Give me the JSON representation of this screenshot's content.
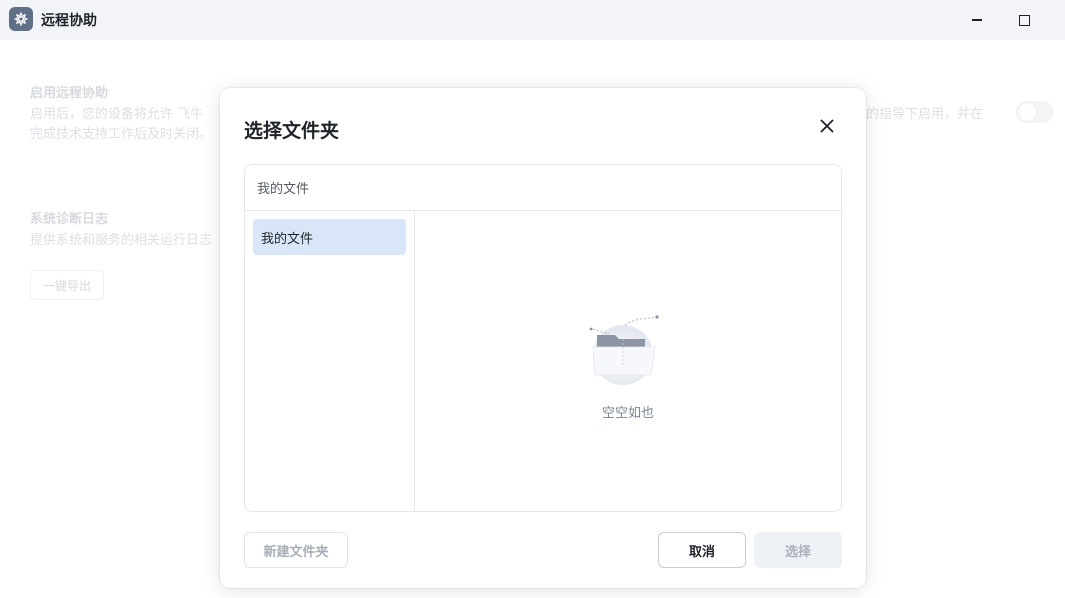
{
  "app": {
    "title": "远程协助",
    "icon": "gear-icon"
  },
  "background": {
    "remote_assist": {
      "title": "启用远程协助",
      "desc_line1_left": "启用后，您的设备将允许 飞牛",
      "desc_line1_right": "的指导下启用，并在",
      "desc_line2": "完成技术支持工作后及时关闭。"
    },
    "diag_log": {
      "title": "系统诊断日志",
      "desc": "提供系统和服务的相关运行日志",
      "export_label": "一键导出"
    }
  },
  "dialog": {
    "title": "选择文件夹",
    "path": "我的文件",
    "tree_items": [
      {
        "label": "我的文件",
        "selected": true
      }
    ],
    "empty_text": "空空如也",
    "new_folder_label": "新建文件夹",
    "cancel_label": "取消",
    "select_label": "选择"
  },
  "colors": {
    "accent_selected": "#d9e6f7",
    "titlebar_bg": "#f2f4f7"
  }
}
